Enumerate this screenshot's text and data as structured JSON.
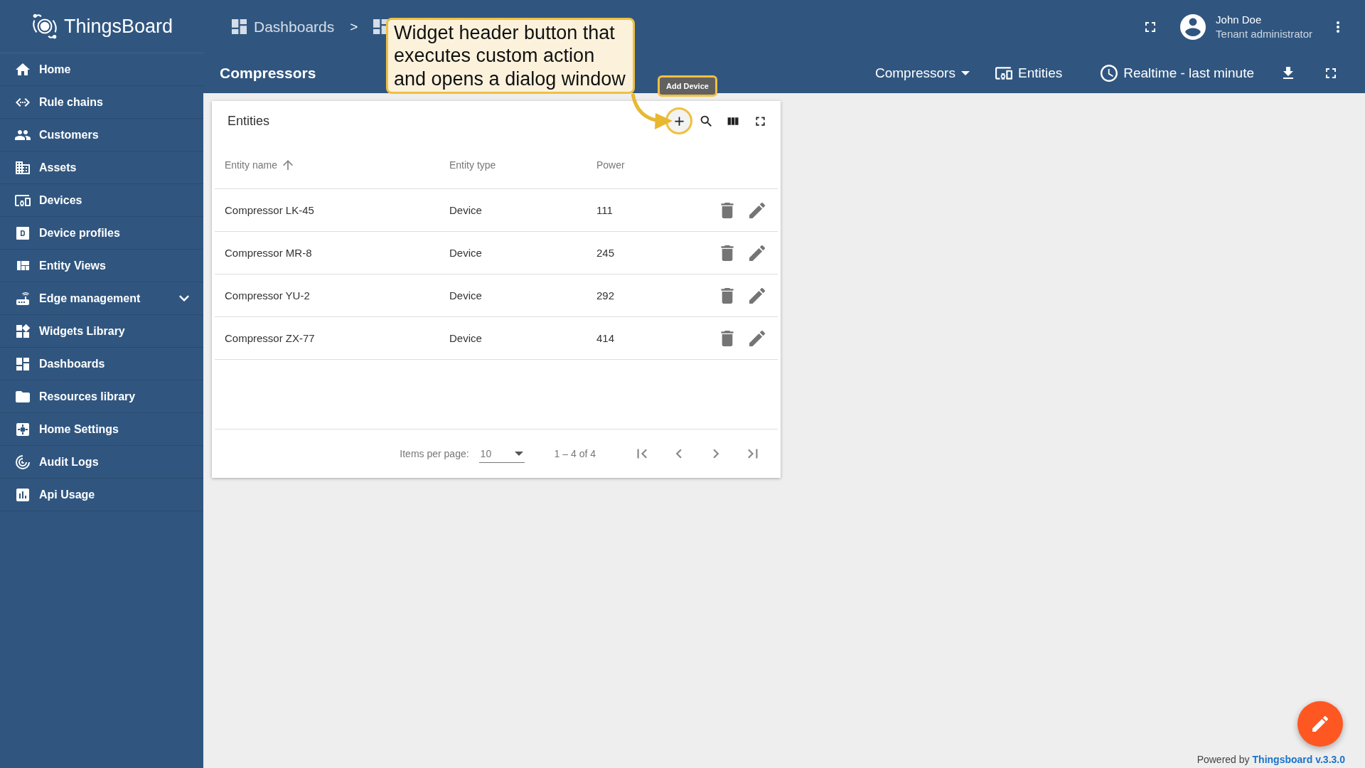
{
  "brand": {
    "name": "ThingsBoard"
  },
  "sidebar": {
    "items": [
      {
        "label": "Home",
        "kind": "link"
      },
      {
        "label": "Rule chains",
        "kind": "link"
      },
      {
        "label": "Customers",
        "kind": "link"
      },
      {
        "label": "Assets",
        "kind": "link"
      },
      {
        "label": "Devices",
        "kind": "link"
      },
      {
        "label": "Device profiles",
        "kind": "link"
      },
      {
        "label": "Entity Views",
        "kind": "link"
      },
      {
        "label": "Edge management",
        "kind": "group"
      },
      {
        "label": "Widgets Library",
        "kind": "link"
      },
      {
        "label": "Dashboards",
        "kind": "link"
      },
      {
        "label": "Resources library",
        "kind": "link"
      },
      {
        "label": "Home Settings",
        "kind": "link"
      },
      {
        "label": "Audit Logs",
        "kind": "link"
      },
      {
        "label": "Api Usage",
        "kind": "link"
      }
    ]
  },
  "breadcrumb": {
    "items": [
      "Dashboards"
    ],
    "separator": ">"
  },
  "user": {
    "name": "John Doe",
    "role": "Tenant administrator"
  },
  "dashboard": {
    "title": "Compressors",
    "state_select": "Compressors",
    "entities_button": "Entities",
    "timewindow": "Realtime - last minute"
  },
  "widget": {
    "title": "Entities",
    "header_buttons": [
      {
        "kind": "add",
        "highlighted": true
      },
      {
        "kind": "search",
        "highlighted": false
      },
      {
        "kind": "columns",
        "highlighted": false
      },
      {
        "kind": "fullscreen",
        "highlighted": false
      }
    ],
    "table": {
      "columns": [
        {
          "label": "Entity name",
          "sorted": true
        },
        {
          "label": "Entity type",
          "sorted": false
        },
        {
          "label": "Power",
          "sorted": false
        }
      ],
      "rows": [
        {
          "cells": [
            "Compressor LK-45",
            "Device",
            "111"
          ]
        },
        {
          "cells": [
            "Compressor MR-8",
            "Device",
            "245"
          ]
        },
        {
          "cells": [
            "Compressor YU-2",
            "Device",
            "292"
          ]
        },
        {
          "cells": [
            "Compressor ZX-77",
            "Device",
            "414"
          ]
        }
      ]
    },
    "paginator": {
      "items_per_page_label": "Items per page:",
      "page_size": "10",
      "range": "1 – 4 of 4"
    }
  },
  "annotation": {
    "callout": "Widget header button that executes custom action and opens a dialog window",
    "tooltip": "Add Device"
  },
  "footer": {
    "prefix": "Powered by",
    "link": "Thingsboard v.3.3.0"
  }
}
